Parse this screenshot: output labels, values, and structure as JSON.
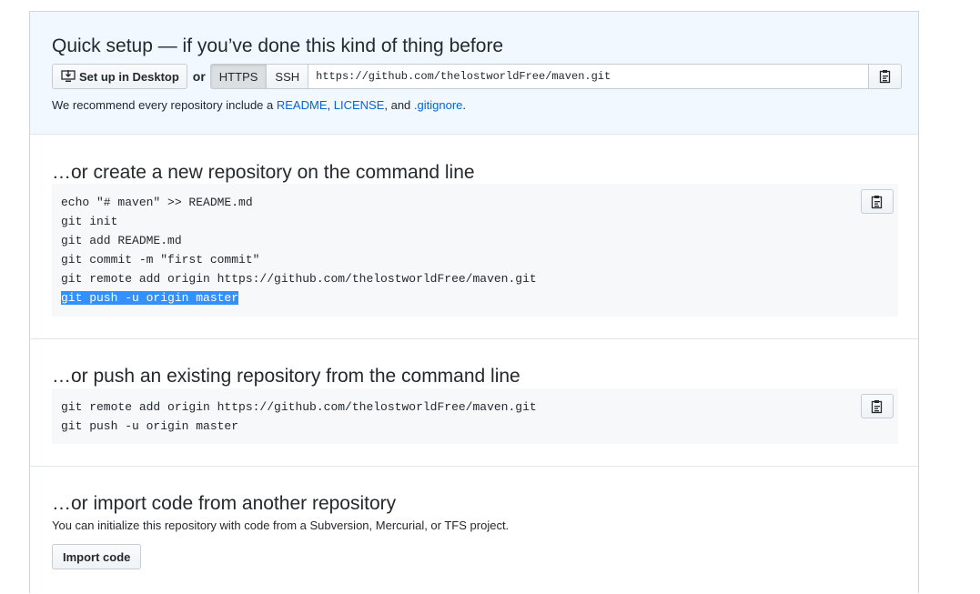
{
  "quick_setup": {
    "title": "Quick setup — if you’ve done this kind of thing before",
    "desktop_button": "Set up in Desktop",
    "or_label": "or",
    "https_label": "HTTPS",
    "ssh_label": "SSH",
    "clone_url": "https://github.com/thelostworldFree/maven.git",
    "recommend_prefix": "We recommend every repository include a ",
    "readme_link": "README",
    "sep1": ", ",
    "license_link": "LICENSE",
    "sep2": ", and ",
    "gitignore_link": ".gitignore",
    "recommend_suffix": "."
  },
  "new_repo": {
    "title": "…or create a new repository on the command line",
    "lines": [
      "echo \"# maven\" >> README.md",
      "git init",
      "git add README.md",
      "git commit -m \"first commit\"",
      "git remote add origin https://github.com/thelostworldFree/maven.git",
      "git push -u origin master"
    ]
  },
  "existing_repo": {
    "title": "…or push an existing repository from the command line",
    "lines": [
      "git remote add origin https://github.com/thelostworldFree/maven.git",
      "git push -u origin master"
    ]
  },
  "import_repo": {
    "title": "…or import code from another repository",
    "description": "You can initialize this repository with code from a Subversion, Mercurial, or TFS project.",
    "button": "Import code"
  },
  "colors": {
    "quick_bg": "#f1f8ff",
    "link": "#0366d6",
    "code_bg": "#f6f8fa",
    "selection": "#3390ff"
  },
  "icons": {
    "desktop": "desktop-download-icon",
    "copy": "clippy-icon"
  }
}
